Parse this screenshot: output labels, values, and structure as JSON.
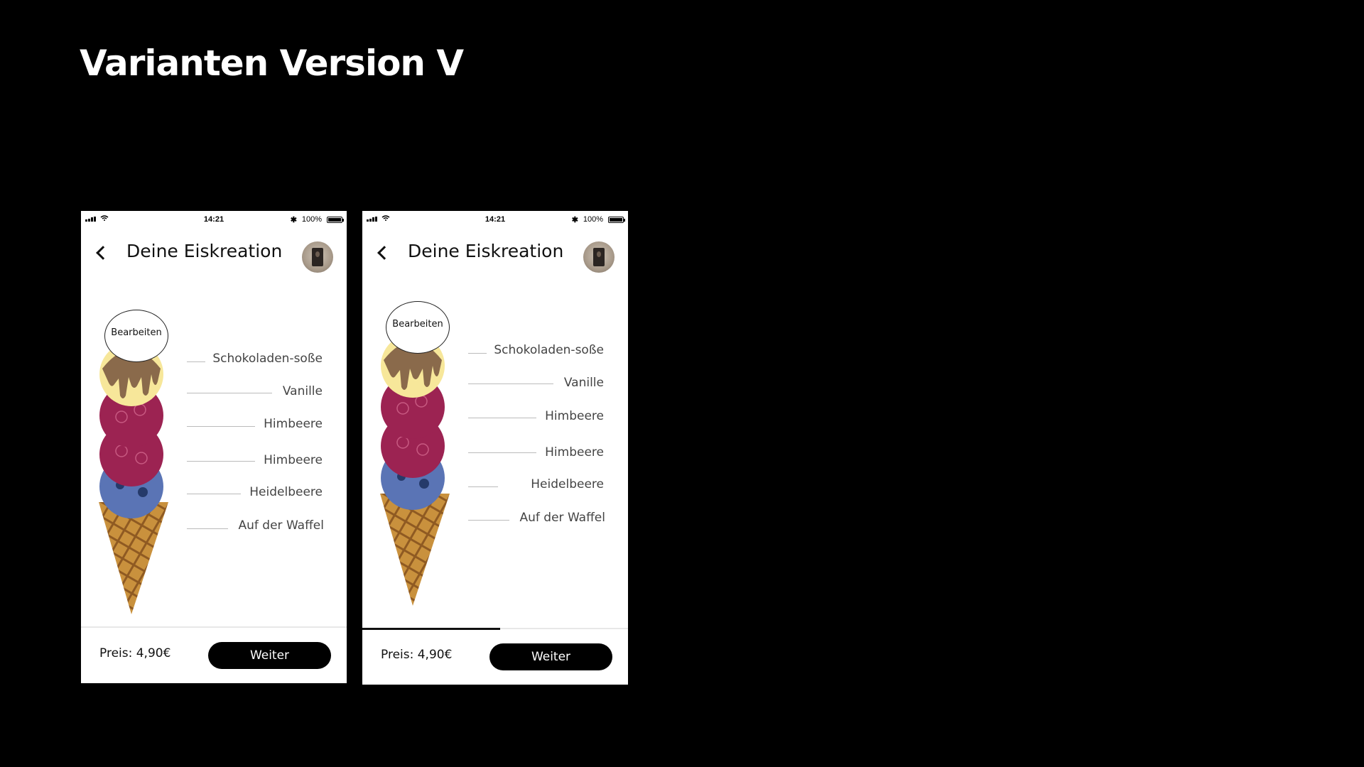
{
  "slide": {
    "title": "Varianten Version V"
  },
  "status": {
    "time": "14:21",
    "battery": "100%",
    "bluetooth": "✱"
  },
  "header": {
    "title": "Deine Eiskreation"
  },
  "editor": {
    "edit_label": "Bearbeiten"
  },
  "toppings": [
    {
      "label": "Schokoladen-soße"
    },
    {
      "label": "Vanille"
    },
    {
      "label": "Himbeere"
    },
    {
      "label": "Himbeere"
    },
    {
      "label": "Heidelbeere"
    },
    {
      "label": "Auf der Waffel"
    }
  ],
  "footer": {
    "price": "Preis: 4,90€",
    "continue_label": "Weiter"
  },
  "variants": [
    {
      "name": "variant-1"
    },
    {
      "name": "variant-2",
      "progress": 0.52
    }
  ],
  "colors": {
    "vanilla": "#f7e79a",
    "raspberry": "#9c2352",
    "blueberry": "#5a74b5",
    "chocolate": "#8a6a4b",
    "waffle": "#c9913d",
    "accent": "#000000"
  },
  "icons": [
    "signal-icon",
    "wifi-icon",
    "bluetooth-icon",
    "battery-icon",
    "back-arrow-icon",
    "avatar"
  ]
}
